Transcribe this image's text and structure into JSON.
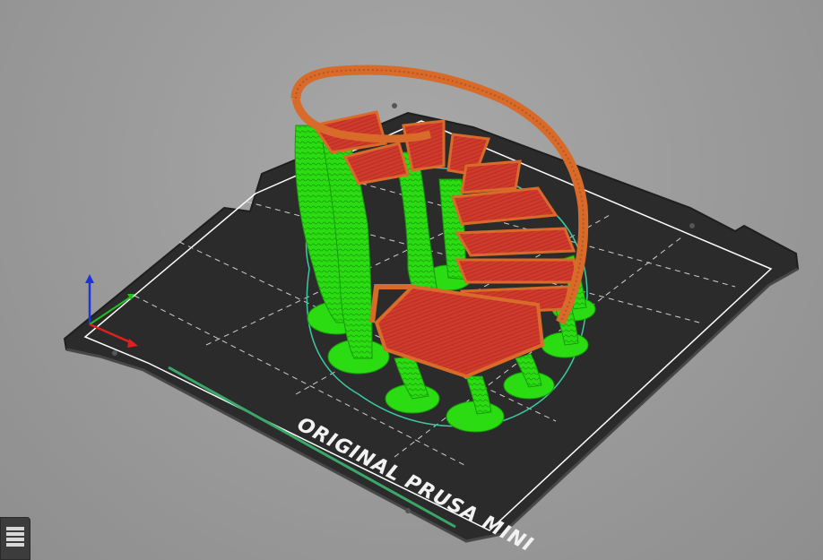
{
  "viewport": {
    "bed_label": "ORIGINAL PRUSA MINI"
  },
  "colors": {
    "background": "#9a9a9a",
    "bed": "#2b2b2b",
    "bed_edge": "#1e1e1e",
    "bed_border_line": "#ffffff",
    "grid_line": "#cfcfcf",
    "support": "#2bdc12",
    "support_dark": "#169a08",
    "perimeter": "#d86a2a",
    "infill": "#cf3a2c",
    "skirt": "#3cc8a0",
    "axis_x": "#e02020",
    "axis_y": "#20c020",
    "axis_z": "#2030e0",
    "bed_stripe": "#3aa86a"
  },
  "icons": {
    "layers": "layers-icon"
  }
}
